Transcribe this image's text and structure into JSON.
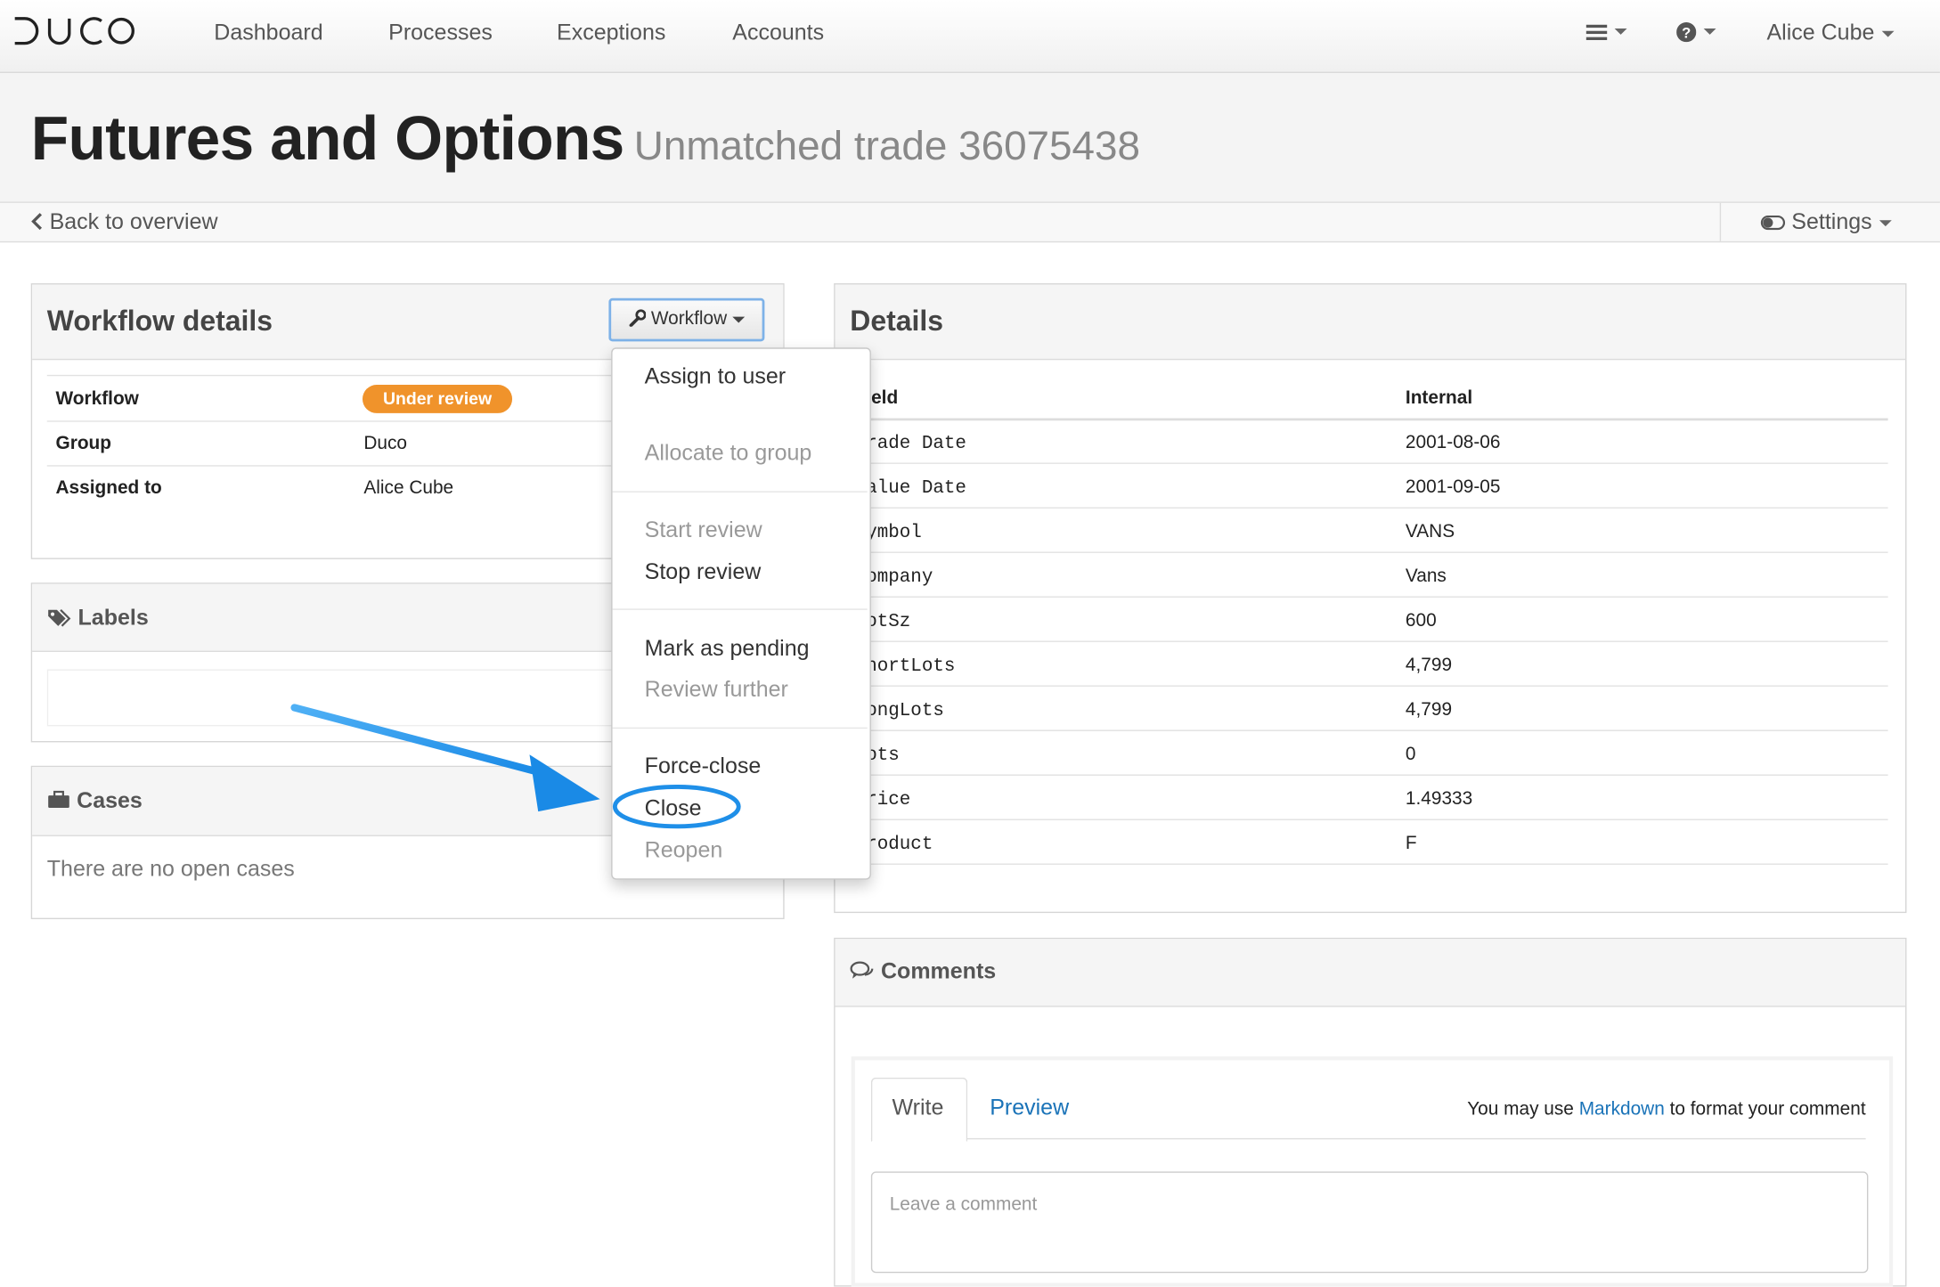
{
  "app": {
    "logo_text": "DUCO"
  },
  "nav": {
    "links": [
      "Dashboard",
      "Processes",
      "Exceptions",
      "Accounts"
    ],
    "user_name": "Alice Cube",
    "menu_icon": "hamburger-icon",
    "help_icon": "question-circle-icon"
  },
  "page": {
    "title": "Futures and Options",
    "subtitle": "Unmatched trade 36075438",
    "back_label": "Back to overview",
    "settings_label": "Settings"
  },
  "workflow_panel": {
    "title": "Workflow details",
    "button_label": "Workflow",
    "rows": [
      {
        "label": "Workflow",
        "value": "Under review"
      },
      {
        "label": "Group",
        "value": "Duco"
      },
      {
        "label": "Assigned to",
        "value": "Alice Cube"
      }
    ],
    "status_color": "#f0932b"
  },
  "labels_panel": {
    "title": "Labels"
  },
  "cases_panel": {
    "title": "Cases",
    "empty_text": "There are no open cases"
  },
  "dropdown": {
    "items": [
      {
        "label": "Assign to user",
        "disabled": false
      },
      {
        "label": "Allocate to group",
        "disabled": true
      },
      {
        "label": "Start review",
        "disabled": true
      },
      {
        "label": "Stop review",
        "disabled": false
      },
      {
        "label": "Mark as pending",
        "disabled": false
      },
      {
        "label": "Review further",
        "disabled": true
      },
      {
        "label": "Force-close",
        "disabled": false
      },
      {
        "label": "Close",
        "disabled": false
      },
      {
        "label": "Reopen",
        "disabled": true
      }
    ],
    "highlighted": "Close",
    "highlight_color": "#1f8fe8"
  },
  "details_panel": {
    "title": "Details",
    "headers": [
      "ield",
      "Internal"
    ],
    "rows": [
      {
        "field": "rade Date",
        "value": "2001-08-06"
      },
      {
        "field": "alue Date",
        "value": "2001-09-05"
      },
      {
        "field": "ymbol",
        "value": "VANS"
      },
      {
        "field": "ompany",
        "value": "Vans"
      },
      {
        "field": "otSz",
        "value": "600"
      },
      {
        "field": "hortLots",
        "value": "4,799"
      },
      {
        "field": "ongLots",
        "value": "4,799"
      },
      {
        "field": "ots",
        "value": "0"
      },
      {
        "field": "rice",
        "value": "1.49333"
      },
      {
        "field": "roduct",
        "value": "F"
      }
    ]
  },
  "comments_panel": {
    "title": "Comments",
    "tab_write": "Write",
    "tab_preview": "Preview",
    "hint_prefix": "You may use",
    "hint_link": "Markdown",
    "hint_suffix": "to format your comment",
    "placeholder": "Leave a comment"
  }
}
